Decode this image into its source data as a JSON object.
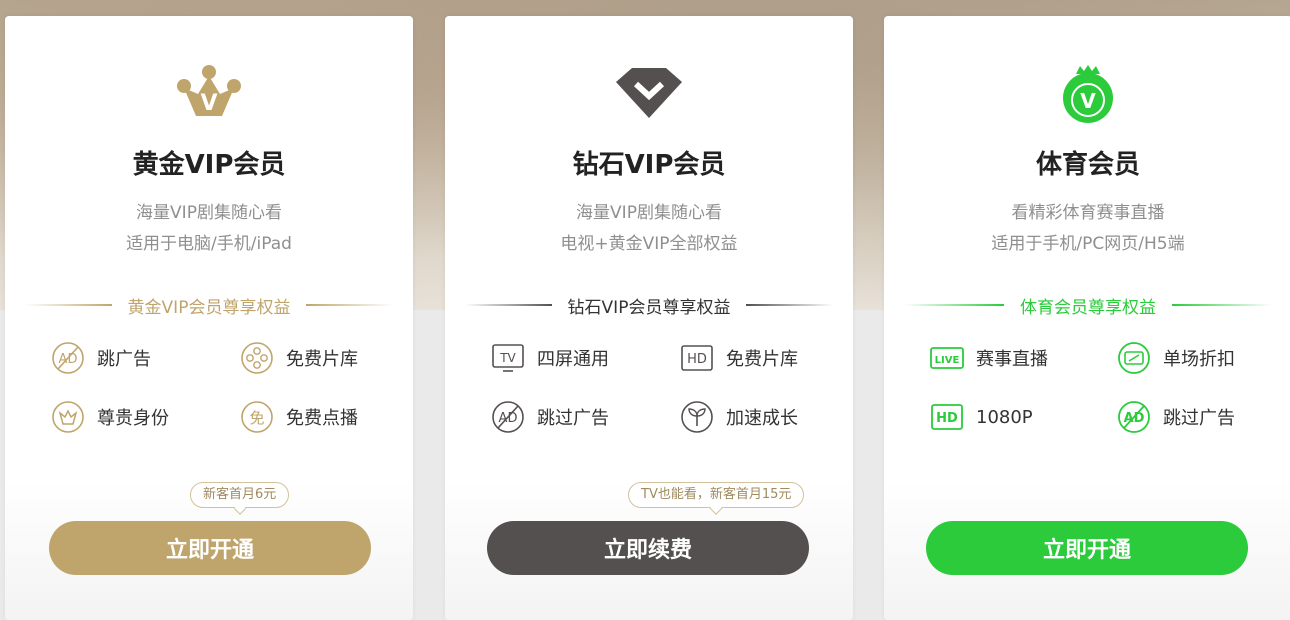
{
  "theme": {
    "gold": "#bfa56c",
    "dark": "#555050",
    "green": "#2bcb3c"
  },
  "cards": [
    {
      "title": "黄金VIP会员",
      "desc": [
        "海量VIP剧集随心看",
        "适用于电脑/手机/iPad"
      ],
      "benefits_title": "黄金VIP会员尊享权益",
      "features": [
        {
          "icon": "no-ads-icon",
          "label": "跳广告"
        },
        {
          "icon": "film-reel-icon",
          "label": "免费片库"
        },
        {
          "icon": "crown-icon",
          "label": "尊贵身份"
        },
        {
          "icon": "free-badge-icon",
          "label": "免费点播"
        }
      ],
      "free_badge_char": "免",
      "promo": "新客首月6元",
      "cta": "立即开通"
    },
    {
      "title": "钻石VIP会员",
      "desc": [
        "海量VIP剧集随心看",
        "电视+黄金VIP全部权益"
      ],
      "benefits_title": "钻石VIP会员尊享权益",
      "features": [
        {
          "icon": "tv-icon",
          "label": "四屏通用"
        },
        {
          "icon": "hd-icon",
          "label": "免费片库"
        },
        {
          "icon": "no-ads-icon",
          "label": "跳过广告"
        },
        {
          "icon": "sprout-icon",
          "label": "加速成长"
        }
      ],
      "promo": "TV也能看，新客首月15元",
      "cta": "立即续费"
    },
    {
      "title": "体育会员",
      "desc": [
        "看精彩体育赛事直播",
        "适用于手机/PC网页/H5端"
      ],
      "benefits_title": "体育会员尊享权益",
      "features": [
        {
          "icon": "live-icon",
          "label": "赛事直播"
        },
        {
          "icon": "discount-ticket-icon",
          "label": "单场折扣"
        },
        {
          "icon": "hd-icon",
          "label": "1080P"
        },
        {
          "icon": "no-ads-icon",
          "label": "跳过广告"
        }
      ],
      "cta": "立即开通"
    }
  ],
  "icon_text": {
    "ad": "AD",
    "tv": "TV",
    "hd": "HD",
    "live": "LIVE",
    "v": "V"
  }
}
